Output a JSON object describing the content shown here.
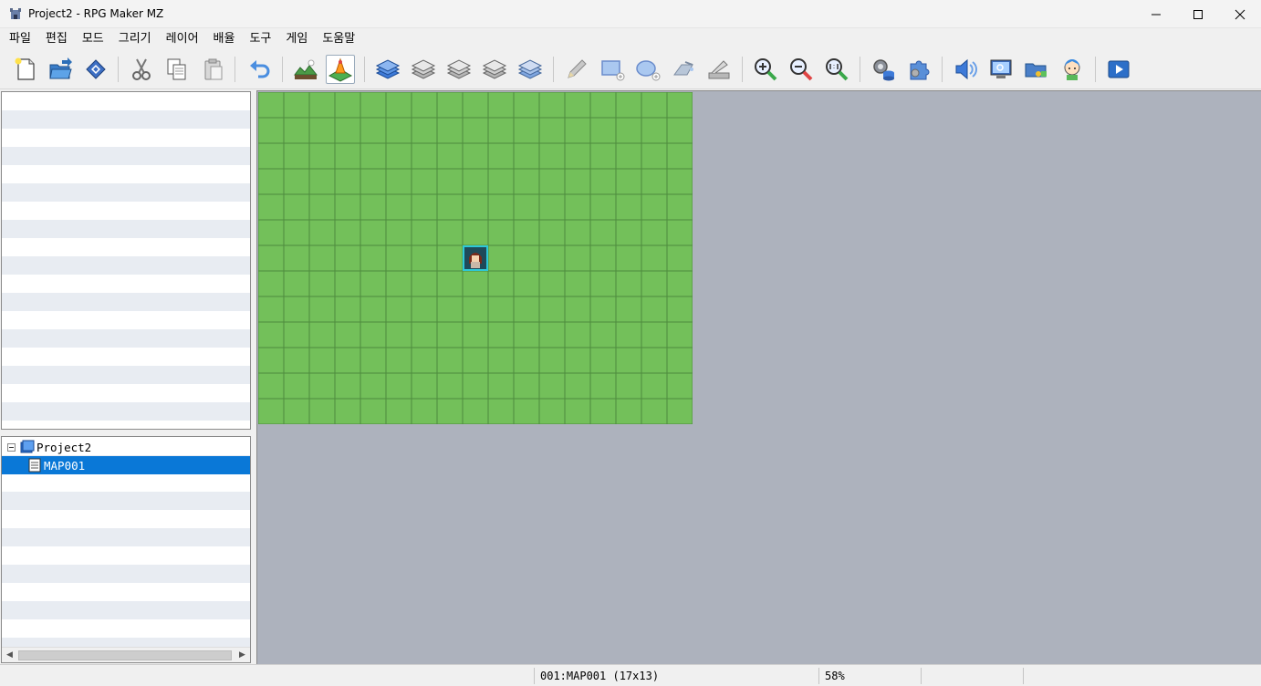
{
  "window": {
    "title": "Project2 - RPG Maker MZ"
  },
  "menu": [
    {
      "label": "파일"
    },
    {
      "label": "편집"
    },
    {
      "label": "모드"
    },
    {
      "label": "그리기"
    },
    {
      "label": "레이어"
    },
    {
      "label": "배율"
    },
    {
      "label": "도구"
    },
    {
      "label": "게임"
    },
    {
      "label": "도움말"
    }
  ],
  "toolbar": {
    "icons": [
      "new-project",
      "open-project",
      "save-project",
      "cut",
      "copy",
      "paste",
      "undo",
      "map-mode",
      "event-mode",
      "layer-1",
      "layer-2",
      "layer-3",
      "layer-4",
      "layer-auto",
      "pencil",
      "rectangle",
      "ellipse",
      "fill",
      "shadow-pen",
      "zoom-in",
      "zoom-out",
      "zoom-actual",
      "database",
      "plugin-manager",
      "sound-test",
      "event-searcher",
      "resource-manager",
      "character-generator",
      "playtest"
    ],
    "active": "event-mode"
  },
  "map_tree": {
    "project": "Project2",
    "maps": [
      {
        "label": "MAP001",
        "selected": true
      }
    ]
  },
  "map": {
    "columns": 17,
    "rows": 13,
    "tile_color": "#73c05a",
    "grid_color": "#4e8a3e",
    "player_start": {
      "col": 8,
      "row": 6
    }
  },
  "status": {
    "map_info": "001:MAP001 (17x13)",
    "zoom": "58%"
  },
  "colors": {
    "selection": "#0a78d7",
    "map_background": "#adb2bd"
  }
}
